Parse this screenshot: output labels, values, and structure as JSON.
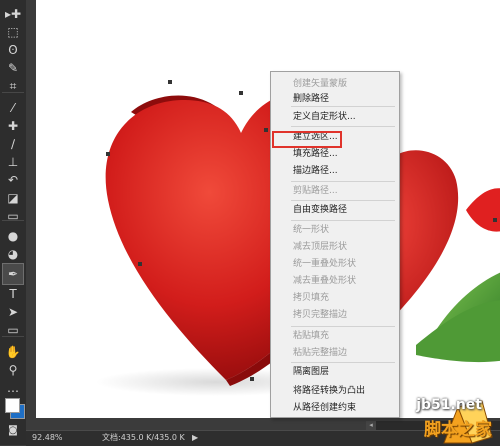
{
  "toolbar": {
    "tools": [
      {
        "name": "move-tool-icon",
        "glyph": "▸✚"
      },
      {
        "name": "marquee-tool-icon",
        "glyph": "⬚"
      },
      {
        "name": "lasso-tool-icon",
        "glyph": "ʘ"
      },
      {
        "name": "quick-select-tool-icon",
        "glyph": "✎"
      },
      {
        "name": "crop-tool-icon",
        "glyph": "⌗"
      },
      {
        "name": "eyedropper-tool-icon",
        "glyph": "⁄"
      },
      {
        "name": "healing-brush-tool-icon",
        "glyph": "✚"
      },
      {
        "name": "brush-tool-icon",
        "glyph": "∕"
      },
      {
        "name": "clone-stamp-tool-icon",
        "glyph": "⊥"
      },
      {
        "name": "history-brush-tool-icon",
        "glyph": "↶"
      },
      {
        "name": "eraser-tool-icon",
        "glyph": "◪"
      },
      {
        "name": "gradient-tool-icon",
        "glyph": "▭"
      },
      {
        "name": "blur-tool-icon",
        "glyph": "●"
      },
      {
        "name": "dodge-tool-icon",
        "glyph": "◕"
      },
      {
        "name": "pen-tool-icon",
        "glyph": "✒"
      },
      {
        "name": "type-tool-icon",
        "glyph": "T"
      },
      {
        "name": "path-select-tool-icon",
        "glyph": "➤"
      },
      {
        "name": "shape-tool-icon",
        "glyph": "▭"
      },
      {
        "name": "hand-tool-icon",
        "glyph": "✋"
      },
      {
        "name": "zoom-tool-icon",
        "glyph": "⚲"
      },
      {
        "name": "more-tools-icon",
        "glyph": "…"
      }
    ],
    "foreground_color": "#ffffff",
    "background_color": "#1f6fc5",
    "quick_mask_icon": "◙"
  },
  "context_menu": {
    "items": [
      {
        "label": "创建矢量蒙版",
        "enabled": false
      },
      {
        "label": "删除路径",
        "enabled": true
      },
      {
        "label": "定义自定形状...",
        "enabled": true
      },
      {
        "label": "建立选区...",
        "enabled": true,
        "highlighted": true
      },
      {
        "label": "填充路径...",
        "enabled": true
      },
      {
        "label": "描边路径...",
        "enabled": true
      },
      {
        "label": "剪贴路径...",
        "enabled": false
      },
      {
        "label": "自由变换路径",
        "enabled": true
      },
      {
        "label": "统一形状",
        "enabled": false
      },
      {
        "label": "减去顶层形状",
        "enabled": false
      },
      {
        "label": "统一重叠处形状",
        "enabled": false
      },
      {
        "label": "减去重叠处形状",
        "enabled": false
      },
      {
        "label": "拷贝填充",
        "enabled": false
      },
      {
        "label": "拷贝完整描边",
        "enabled": false
      },
      {
        "label": "粘贴填充",
        "enabled": false
      },
      {
        "label": "粘贴完整描边",
        "enabled": false
      },
      {
        "label": "隔离图层",
        "enabled": true
      },
      {
        "label": "将路径转换为凸出",
        "enabled": true
      },
      {
        "label": "从路径创建约束",
        "enabled": true
      }
    ],
    "highlight_color": "#e0332b"
  },
  "status": {
    "zoom": "92.48%",
    "doc": "文档:435.0 K/435.0 K",
    "arrow": "▶"
  },
  "watermark": {
    "url": "jb51.net",
    "name": "脚本之家"
  },
  "colors": {
    "heart_red": "#d8201e",
    "leaf_green": "#5aa43c"
  }
}
